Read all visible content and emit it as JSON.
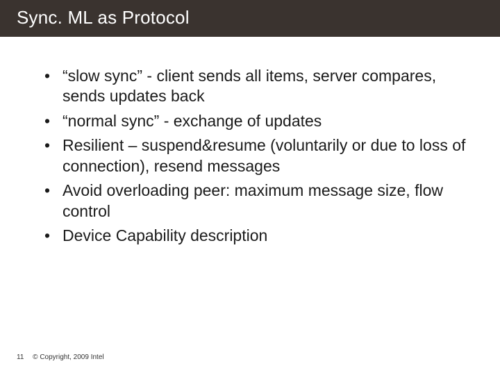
{
  "title": "Sync. ML as Protocol",
  "bullets": [
    "“slow sync” - client sends all items, server compares, sends updates back",
    "“normal sync” - exchange of updates",
    "Resilient – suspend&resume (voluntarily or due to loss of connection), resend messages",
    "Avoid overloading peer: maximum message size, flow control",
    "Device Capability description"
  ],
  "page_number": "11",
  "copyright": "© Copyright, 2009 Intel"
}
